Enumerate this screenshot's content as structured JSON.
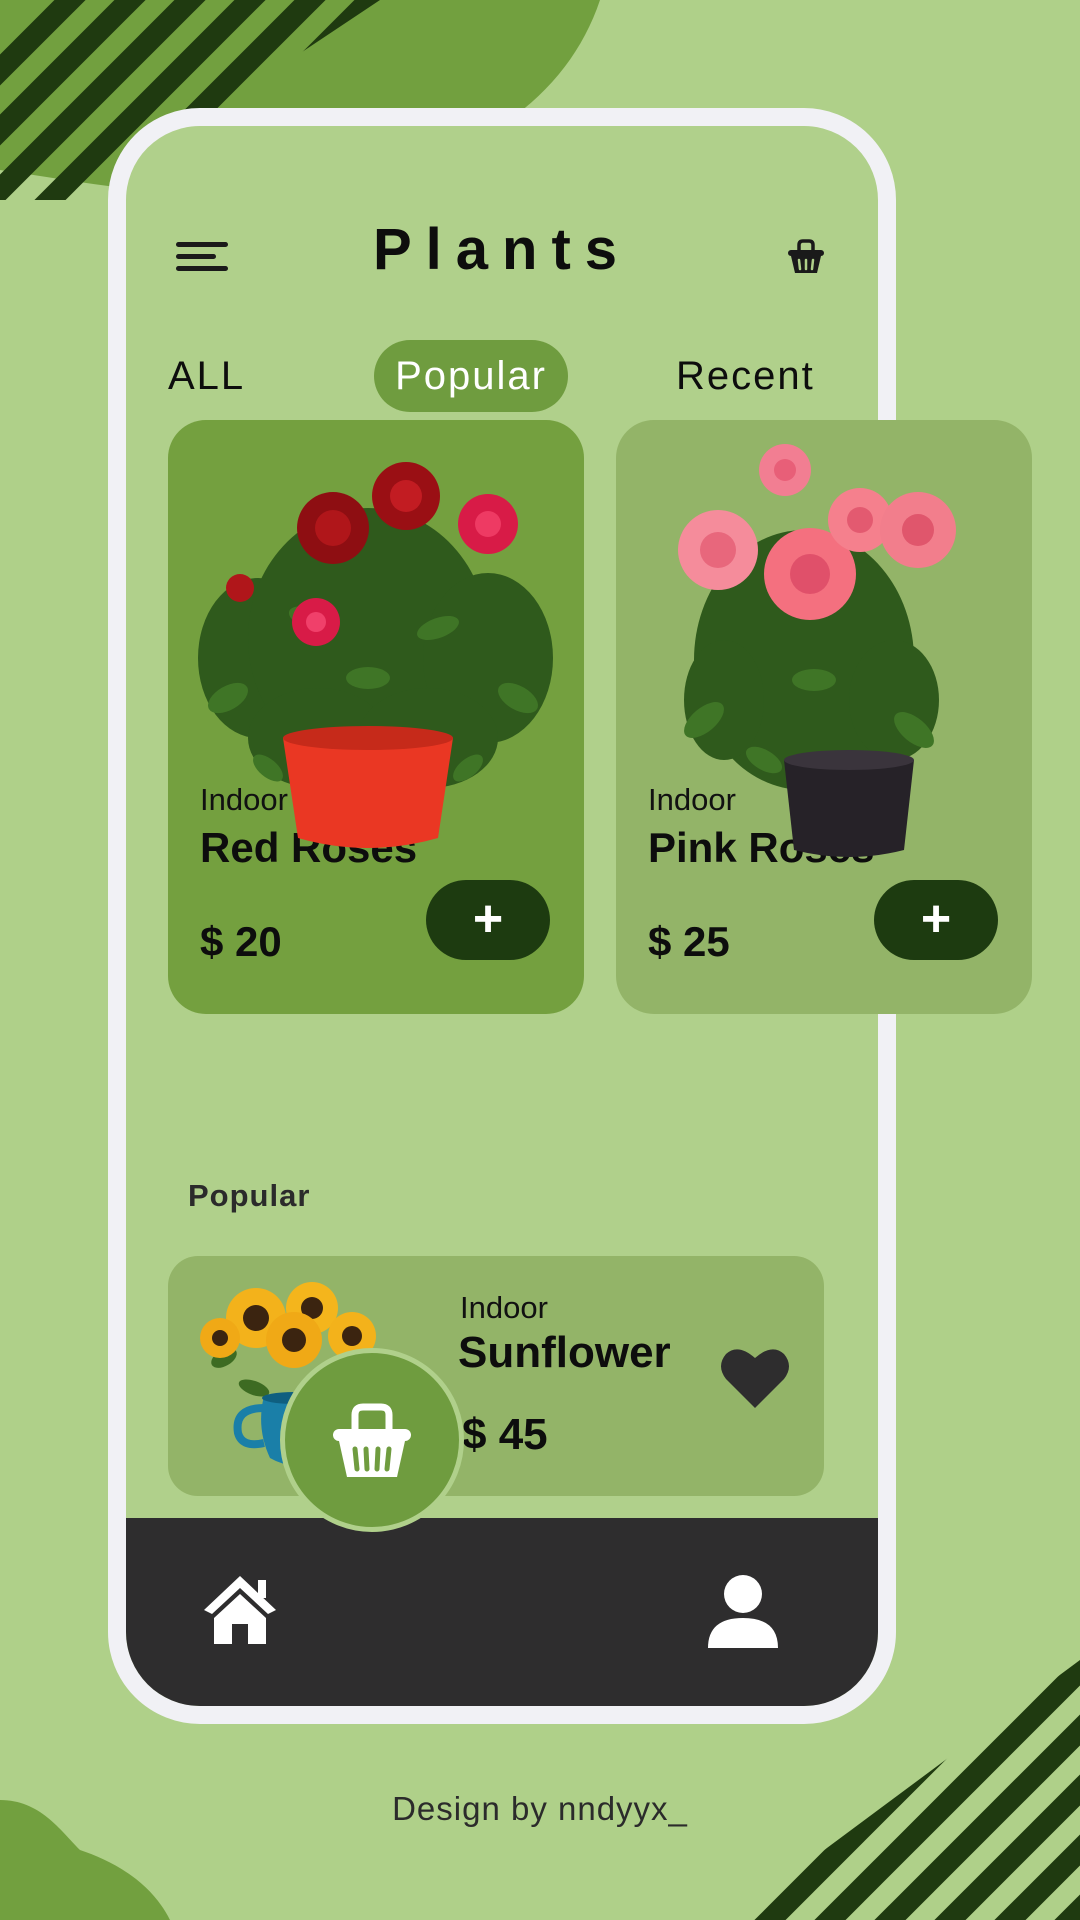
{
  "header": {
    "title": "Plants"
  },
  "tabs": [
    {
      "label": "ALL"
    },
    {
      "label": "Popular",
      "active": true
    },
    {
      "label": "Recent"
    }
  ],
  "products": [
    {
      "category": "Indoor",
      "name": "Red Roses",
      "price": "$ 20",
      "add_label": "+"
    },
    {
      "category": "Indoor",
      "name": "Pink Roses",
      "price": "$ 25",
      "add_label": "+"
    }
  ],
  "popular": {
    "section_title": "Popular",
    "item": {
      "category": "Indoor",
      "name": "Sunflower",
      "price": "$ 45"
    }
  },
  "bottom_nav": {
    "items": [
      "home-icon",
      "basket-icon",
      "user-icon"
    ]
  },
  "footer": {
    "credit": "Design by nndyyx_"
  },
  "colors": {
    "background": "#afd089",
    "accent_green": "#6f9c3f",
    "card_dark_green": "#74a03f",
    "card_light_green": "#93b468",
    "button_dark": "#1d3b10",
    "nav_dark": "#2e2d2e",
    "frame": "#f1f1f5"
  }
}
